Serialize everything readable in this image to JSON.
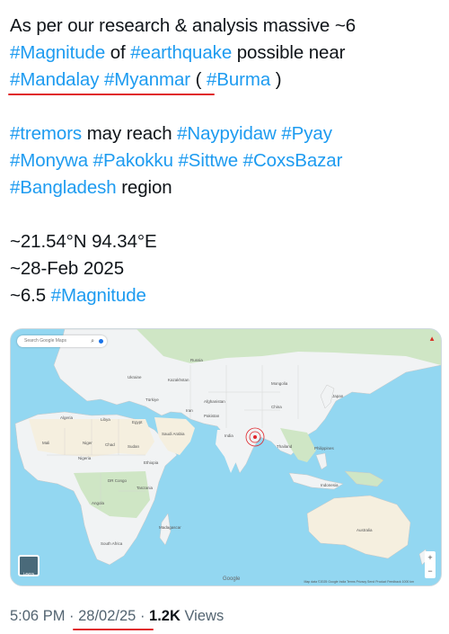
{
  "tweet": {
    "line1": "As per our research & analysis massive ~6",
    "l2_tag1": "#Magnitude",
    "l2_of": " of ",
    "l2_tag2": "#earthquake",
    "l2_rest": " possible near",
    "l3_tag1": "#Mandalay",
    "l3_tag2": "#Myanmar",
    "l3_paren_open": " ( ",
    "l3_tag3": "#Burma",
    "l3_paren_close": " )",
    "l5_tag1": "#tremors",
    "l5_text": " may reach ",
    "l5_tag2": "#Naypyidaw",
    "l5_tag3": "#Pyay",
    "l6_tag1": "#Monywa",
    "l6_tag2": "#Pakokku",
    "l6_tag3": "#Sittwe",
    "l6_tag4": "#CoxsBazar",
    "l7_tag1": "#Bangladesh",
    "l7_text": " region",
    "coords": "~21.54°N 94.34°E",
    "date": "~28-Feb 2025",
    "mag_value": "~6.5 ",
    "mag_tag": "#Magnitude"
  },
  "map": {
    "search_placeholder": "Search Google Maps",
    "layers_label": "Layers",
    "logo": "Google",
    "footer": "Map data ©2025 Google   India   Terms   Privacy   Send Product Feedback   1000 km",
    "labels": {
      "russia": "Russia",
      "kazakhstan": "Kazakhstan",
      "mongolia": "Mongolia",
      "china": "China",
      "india": "India",
      "iran": "Iran",
      "saudi": "Saudi Arabia",
      "egypt": "Egypt",
      "libya": "Libya",
      "algeria": "Algeria",
      "niger": "Niger",
      "chad": "Chad",
      "sudan": "Sudan",
      "nigeria": "Nigeria",
      "ethiopia": "Ethiopia",
      "drc": "DR Congo",
      "angola": "Angola",
      "tanzania": "Tanzania",
      "madagascar": "Madagascar",
      "south_africa": "South Africa",
      "turkey": "Türkiye",
      "afghanistan": "Afghanistan",
      "pakistan": "Pakistan",
      "japan": "Japan",
      "indonesia": "Indonesia",
      "australia": "Australia",
      "thailand": "Thailand",
      "philippines": "Philippines",
      "ukraine": "Ukraine",
      "mali": "Mali"
    }
  },
  "meta": {
    "time": "5:06 PM",
    "sep1": " · ",
    "date": "28/02/25",
    "sep2": " · ",
    "views_count": "1.2K",
    "views_label": " Views"
  },
  "colors": {
    "hashtag": "#1d9bf0",
    "underline": "#e0252a",
    "water": "#93d7f1",
    "land": "#f1f3f4",
    "forest": "#cfe6c5",
    "desert": "#f5efdf"
  }
}
